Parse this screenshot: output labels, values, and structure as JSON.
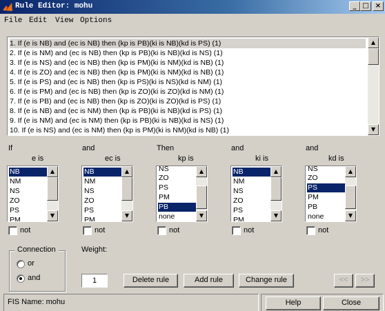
{
  "window": {
    "title": "Rule Editor: mohu"
  },
  "menu": {
    "items": [
      "File",
      "Edit",
      "View",
      "Options"
    ]
  },
  "rules": [
    "1. If (e is NB) and (ec is NB) then (kp is PB)(ki is NB)(kd is PS) (1)",
    "2. If (e is NM) and (ec is NB) then (kp is PB)(ki is NB)(kd is NS) (1)",
    "3. If (e is NS) and (ec is NB) then (kp is PM)(ki is NM)(kd is NB) (1)",
    "4. If (e is ZO) and (ec is NB) then (kp is PM)(ki is NM)(kd is NB) (1)",
    "5. If (e is PS) and (ec is NB) then (kp is PS)(ki is NS)(kd is NM) (1)",
    "6. If (e is PM) and (ec is NB) then (kp is ZO)(ki is ZO)(kd is NM) (1)",
    "7. If (e is PB) and (ec is NB) then (kp is ZO)(ki is ZO)(kd is PS) (1)",
    "8. If (e is NB) and (ec is NM) then (kp is PB)(ki is NB)(kd is PS) (1)",
    "9. If (e is NM) and (ec is NM) then (kp is PB)(ki is NB)(kd is NS) (1)",
    "10. If (e is NS) and (ec is NM) then (kp is PM)(ki is NM)(kd is NB) (1)"
  ],
  "selected_rule_index": 0,
  "columns": [
    {
      "prefix": "If",
      "label": "e is",
      "options": [
        "NB",
        "NM",
        "NS",
        "ZO",
        "PS",
        "PM"
      ],
      "selected": "NB",
      "not_label": "not"
    },
    {
      "prefix": "and",
      "label": "ec is",
      "options": [
        "NB",
        "NM",
        "NS",
        "ZO",
        "PS",
        "PM"
      ],
      "selected": "NB",
      "not_label": "not"
    },
    {
      "prefix": "Then",
      "label": "kp is",
      "options": [
        "NS",
        "ZO",
        "PS",
        "PM",
        "PB",
        "none"
      ],
      "selected": "PB",
      "not_label": "not"
    },
    {
      "prefix": "and",
      "label": "ki is",
      "options": [
        "NB",
        "NM",
        "NS",
        "ZO",
        "PS",
        "PM"
      ],
      "selected": "NB",
      "not_label": "not"
    },
    {
      "prefix": "and",
      "label": "kd is",
      "options": [
        "NS",
        "ZO",
        "PS",
        "PM",
        "PB",
        "none"
      ],
      "selected": "PS",
      "not_label": "not"
    }
  ],
  "connection": {
    "title": "Connection",
    "options": [
      "or",
      "and"
    ],
    "selected": "and"
  },
  "weight": {
    "label": "Weight:",
    "value": "1"
  },
  "buttons": {
    "delete": "Delete rule",
    "add": "Add rule",
    "change": "Change rule",
    "prev": "<<",
    "next": ">>"
  },
  "status": {
    "fis_name": "FIS Name: mohu"
  },
  "footer": {
    "help": "Help",
    "close": "Close"
  },
  "colors": {
    "title_bar": "#0a246a",
    "selection": "#0a246a",
    "face": "#d4d0c8"
  }
}
